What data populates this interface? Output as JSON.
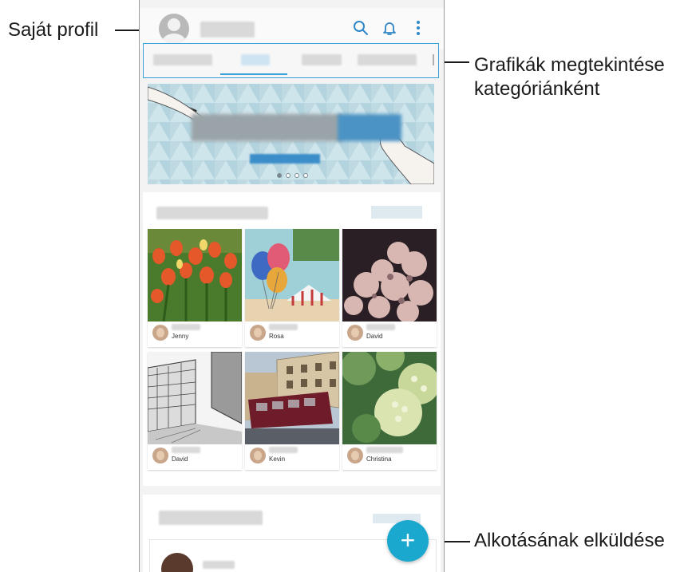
{
  "callouts": {
    "profile": "Saját profil",
    "categories_line1": "Grafikák megtekintése",
    "categories_line2": "kategóriánként",
    "submit": "Alkotásának elküldése"
  },
  "topbar": {
    "icons": [
      "search-icon",
      "bell-icon",
      "more-vert-icon"
    ]
  },
  "tiles": [
    {
      "name": "Jenny"
    },
    {
      "name": "Rosa"
    },
    {
      "name": "David"
    },
    {
      "name": "David"
    },
    {
      "name": "Kevin"
    },
    {
      "name": "Christina"
    }
  ],
  "fab": {
    "label": "+"
  },
  "colors": {
    "accent": "#3aa0d8",
    "fab": "#1aa8cf"
  }
}
